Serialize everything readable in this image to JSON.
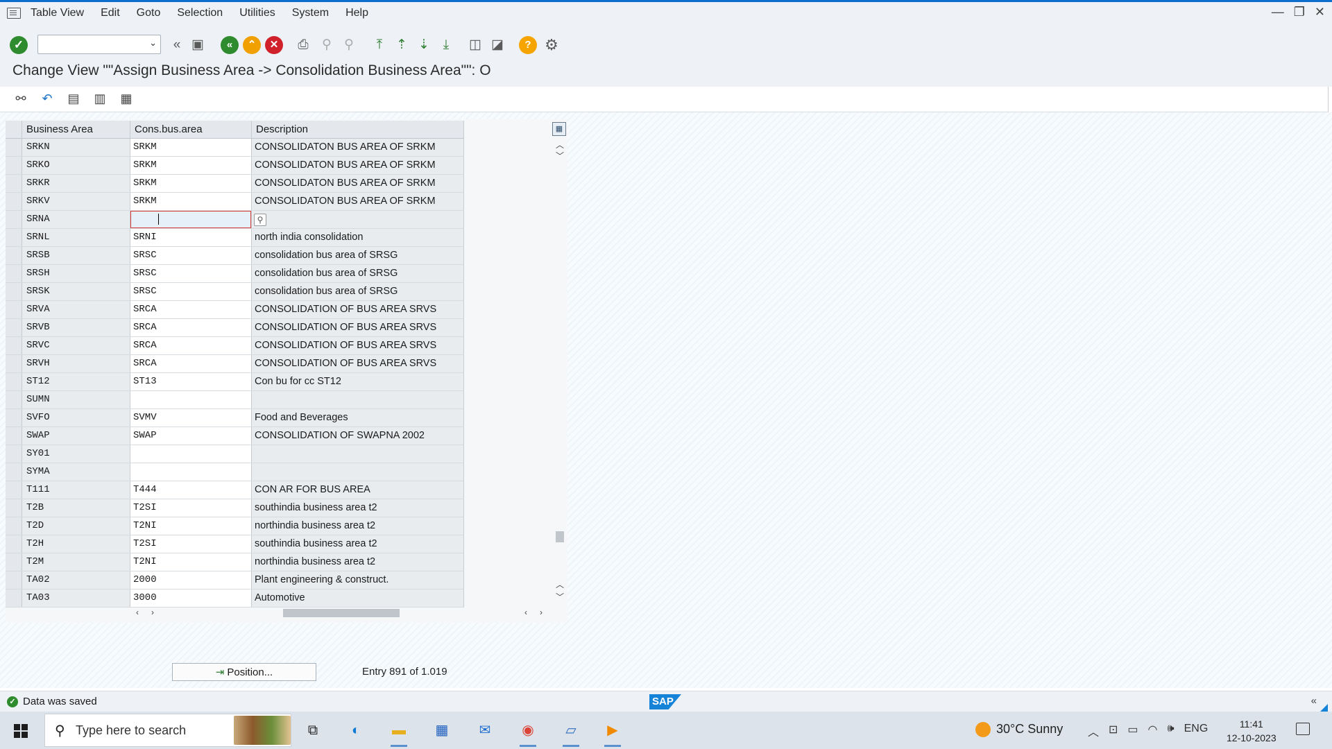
{
  "menu": [
    "Table View",
    "Edit",
    "Goto",
    "Selection",
    "Utilities",
    "System",
    "Help"
  ],
  "window_controls": [
    "—",
    "❐",
    "✕"
  ],
  "toolbar": {
    "command_field_value": "",
    "icons": [
      "enter-icon",
      "back-icon",
      "save-icon",
      "exit-icon",
      "up-icon",
      "cancel-icon",
      "print-icon",
      "find-icon",
      "find-next-icon",
      "first-page-icon",
      "previous-page-icon",
      "next-page-icon",
      "last-page-icon",
      "new-session-icon",
      "shortcut-icon",
      "help-icon",
      "settings-icon"
    ]
  },
  "title": "Change View \"\"Assign Business Area -> Consolidation Business Area\"\": O",
  "app_toolbar": {
    "icons": [
      "display-change-icon",
      "undo-icon",
      "select-all-icon",
      "select-block-icon",
      "deselect-all-icon"
    ]
  },
  "table": {
    "headers": [
      "Business Area",
      "Cons.bus.area",
      "Description"
    ],
    "rows": [
      [
        "SRKN",
        "SRKM",
        "CONSOLIDATON BUS AREA OF SRKM"
      ],
      [
        "SRKO",
        "SRKM",
        "CONSOLIDATON BUS AREA OF SRKM"
      ],
      [
        "SRKR",
        "SRKM",
        "CONSOLIDATON BUS AREA OF SRKM"
      ],
      [
        "SRKV",
        "SRKM",
        "CONSOLIDATON BUS AREA OF SRKM"
      ],
      [
        "SRNA",
        "",
        ""
      ],
      [
        "SRNL",
        "SRNI",
        "north india consolidation"
      ],
      [
        "SRSB",
        "SRSC",
        "consolidation bus area of SRSG"
      ],
      [
        "SRSH",
        "SRSC",
        "consolidation bus area of SRSG"
      ],
      [
        "SRSK",
        "SRSC",
        "consolidation bus area of SRSG"
      ],
      [
        "SRVA",
        "SRCA",
        "CONSOLIDATION OF BUS AREA SRVS"
      ],
      [
        "SRVB",
        "SRCA",
        "CONSOLIDATION OF BUS AREA SRVS"
      ],
      [
        "SRVC",
        "SRCA",
        "CONSOLIDATION OF BUS AREA SRVS"
      ],
      [
        "SRVH",
        "SRCA",
        "CONSOLIDATION OF BUS AREA SRVS"
      ],
      [
        "ST12",
        "ST13",
        "Con bu for cc ST12"
      ],
      [
        "SUMN",
        "",
        ""
      ],
      [
        "SVFO",
        "SVMV",
        "Food and Beverages"
      ],
      [
        "SWAP",
        "SWAP",
        "CONSOLIDATION OF SWAPNA 2002"
      ],
      [
        "SY01",
        "",
        ""
      ],
      [
        "SYMA",
        "",
        ""
      ],
      [
        "T111",
        "T444",
        "CON AR FOR BUS AREA"
      ],
      [
        "T2B",
        "T2SI",
        "southindia business area t2"
      ],
      [
        "T2D",
        "T2NI",
        "northindia business area t2"
      ],
      [
        "T2H",
        "T2SI",
        "southindia business area t2"
      ],
      [
        "T2M",
        "T2NI",
        "northindia business area t2"
      ],
      [
        "TA02",
        "2000",
        "Plant engineering & construct."
      ],
      [
        "TA03",
        "3000",
        "Automotive"
      ]
    ],
    "editing_row": 4
  },
  "footer": {
    "position_button": "Position...",
    "entry_info": "Entry 891 of 1.019"
  },
  "status": {
    "message": "Data was saved",
    "logo": "SAP",
    "collapse": "«"
  },
  "taskbar": {
    "search_placeholder": "Type here to search",
    "weather": "30°C  Sunny",
    "language": "ENG",
    "time": "11:41",
    "date": "12-10-2023"
  }
}
